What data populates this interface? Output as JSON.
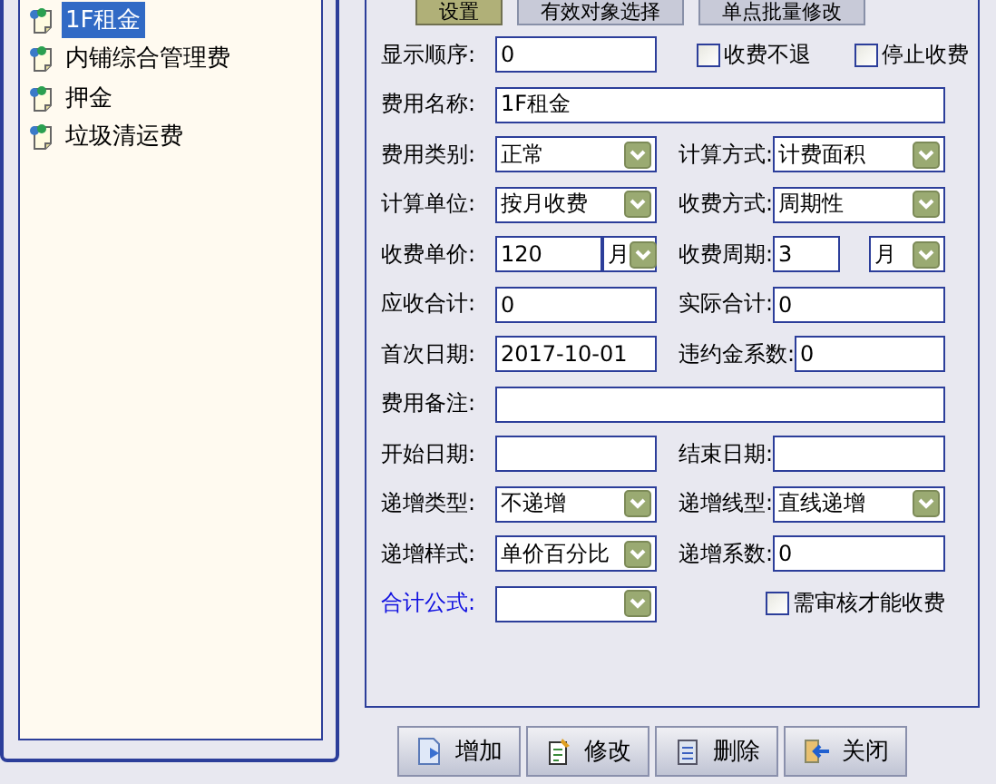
{
  "tree": {
    "items": [
      {
        "label": "1F租金",
        "selected": true
      },
      {
        "label": "内铺综合管理费",
        "selected": false
      },
      {
        "label": "押金",
        "selected": false
      },
      {
        "label": "垃圾清运费",
        "selected": false
      }
    ]
  },
  "tabs": [
    {
      "label": "设置",
      "selected": true
    },
    {
      "label": "有效对象选择",
      "selected": false
    },
    {
      "label": "单点批量修改",
      "selected": false
    }
  ],
  "form": {
    "rows": [
      [
        {
          "kind": "text",
          "label": "显示顺序:",
          "value": "0"
        },
        {
          "kind": "checkbox-pair",
          "items": [
            {
              "label": "收费不退",
              "checked": false
            },
            {
              "label": "停止收费",
              "checked": false
            }
          ]
        }
      ],
      [
        {
          "kind": "text",
          "label": "费用名称:",
          "value": "1F租金"
        }
      ],
      [
        {
          "kind": "select",
          "label": "费用类别:",
          "value": "正常"
        },
        {
          "kind": "select",
          "label": "计算方式:",
          "value": "计费面积"
        }
      ],
      [
        {
          "kind": "select",
          "label": "计算单位:",
          "value": "按月收费"
        },
        {
          "kind": "select",
          "label": "收费方式:",
          "value": "周期性"
        }
      ],
      [
        {
          "kind": "text-unit",
          "label": "收费单价:",
          "value": "120",
          "unit": "月"
        },
        {
          "kind": "text-unit",
          "label": "收费周期:",
          "value": "3",
          "unit": "月"
        }
      ],
      [
        {
          "kind": "text",
          "label": "应收合计:",
          "value": "0"
        },
        {
          "kind": "text",
          "label": "实际合计:",
          "value": "0"
        }
      ],
      [
        {
          "kind": "text",
          "label": "首次日期:",
          "value": "2017-10-01"
        },
        {
          "kind": "text",
          "label": "违约金系数:",
          "value": "0"
        }
      ],
      [
        {
          "kind": "text",
          "label": "费用备注:"
        }
      ],
      [
        {
          "kind": "text",
          "label": "开始日期:"
        },
        {
          "kind": "text",
          "label": "结束日期:"
        }
      ],
      [
        {
          "kind": "select",
          "label": "递增类型:",
          "value": "不递增"
        },
        {
          "kind": "select",
          "label": "递增线型:",
          "value": "直线递增"
        }
      ],
      [
        {
          "kind": "select",
          "label": "递增样式:",
          "value": "单价百分比"
        },
        {
          "kind": "text",
          "label": "递增系数:",
          "value": "0"
        }
      ],
      [
        {
          "kind": "select",
          "label": "合计公式:",
          "link": true
        },
        {
          "kind": "checkbox",
          "label": "需审核才能收费",
          "checked": false
        }
      ]
    ]
  },
  "buttons": [
    {
      "label": "增加",
      "kind": "add"
    },
    {
      "label": "修改",
      "kind": "edit"
    },
    {
      "label": "删除",
      "kind": "delete"
    },
    {
      "label": "关闭",
      "kind": "close"
    }
  ]
}
